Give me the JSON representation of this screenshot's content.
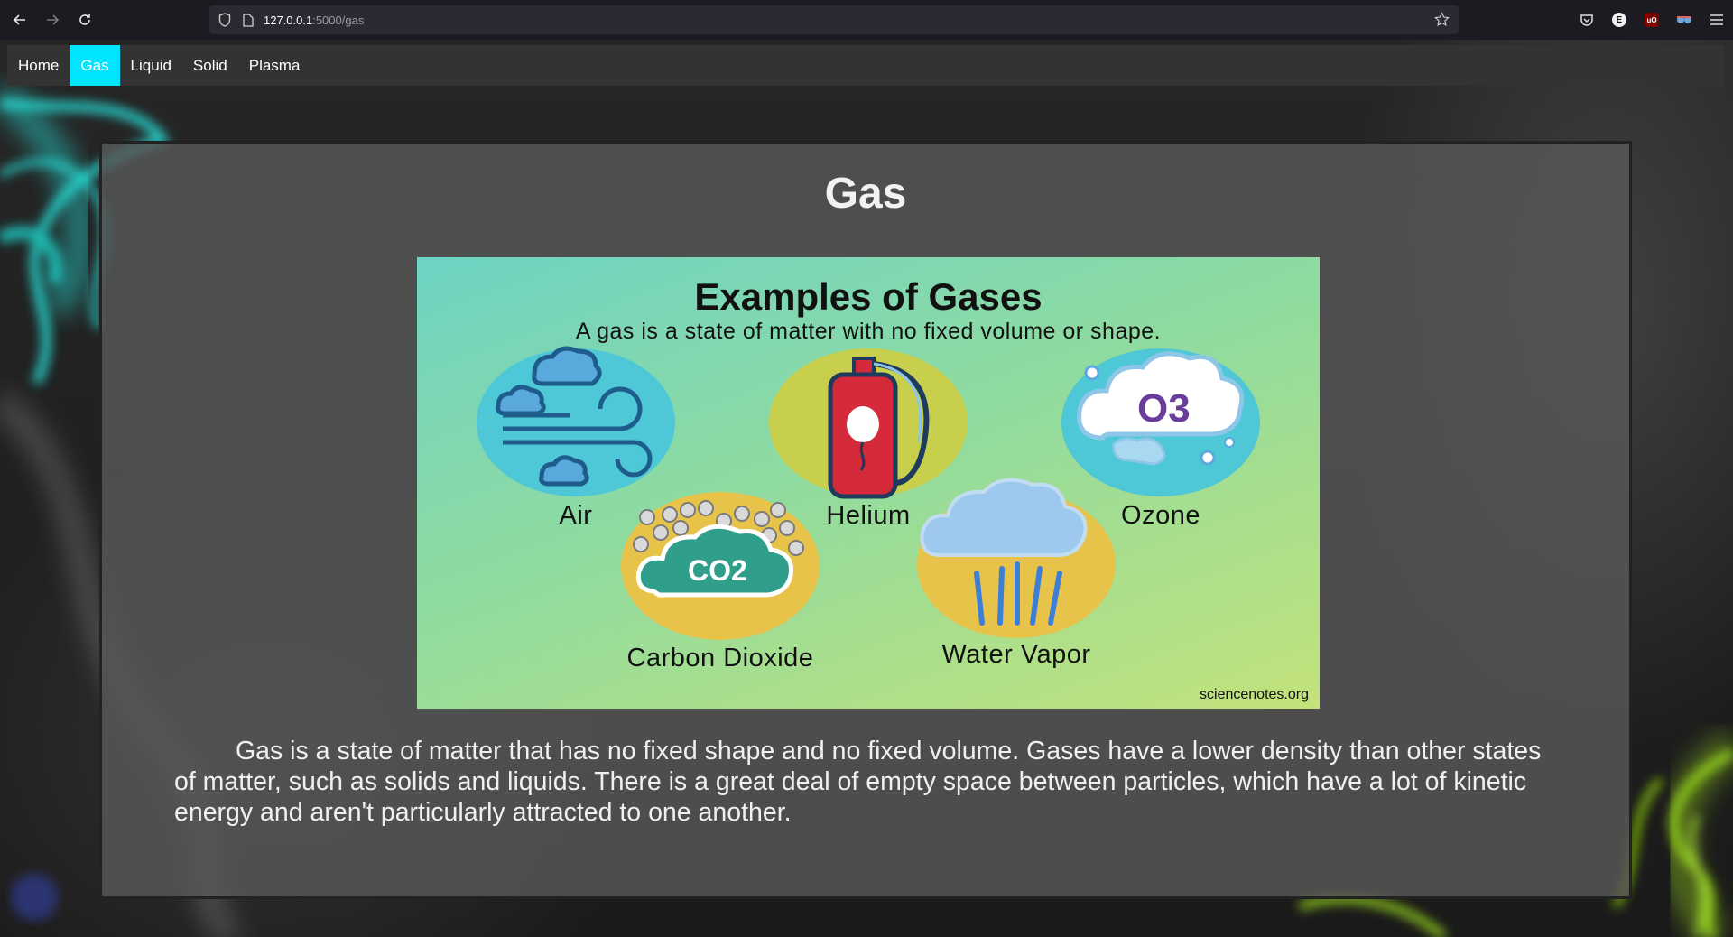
{
  "browser": {
    "url_host": "127.0.0.1",
    "url_path": ":5000/gas"
  },
  "nav": {
    "items": [
      {
        "label": "Home",
        "active": false
      },
      {
        "label": "Gas",
        "active": true
      },
      {
        "label": "Liquid",
        "active": false
      },
      {
        "label": "Solid",
        "active": false
      },
      {
        "label": "Plasma",
        "active": false
      }
    ]
  },
  "page": {
    "title": "Gas",
    "description": "Gas is a state of matter that has no fixed shape and no fixed volume. Gases have a lower density than other states of matter, such as solids and liquids. There is a great deal of empty space between particles, which have a lot of kinetic energy and aren't particularly attracted to one another."
  },
  "infographic": {
    "title": "Examples of Gases",
    "subtitle": "A gas is a state of matter with no fixed volume or shape.",
    "labels": {
      "air": "Air",
      "helium": "Helium",
      "ozone": "Ozone",
      "co2": "Carbon Dioxide",
      "water_vapor": "Water Vapor"
    },
    "ozone_formula": "O3",
    "co2_formula": "CO2",
    "credit": "sciencenotes.org"
  },
  "colors": {
    "nav_active": "#00e5ff",
    "nav_bg": "#333333",
    "smoke_cyan": "#27e6df",
    "smoke_green": "#9bdc1a"
  }
}
